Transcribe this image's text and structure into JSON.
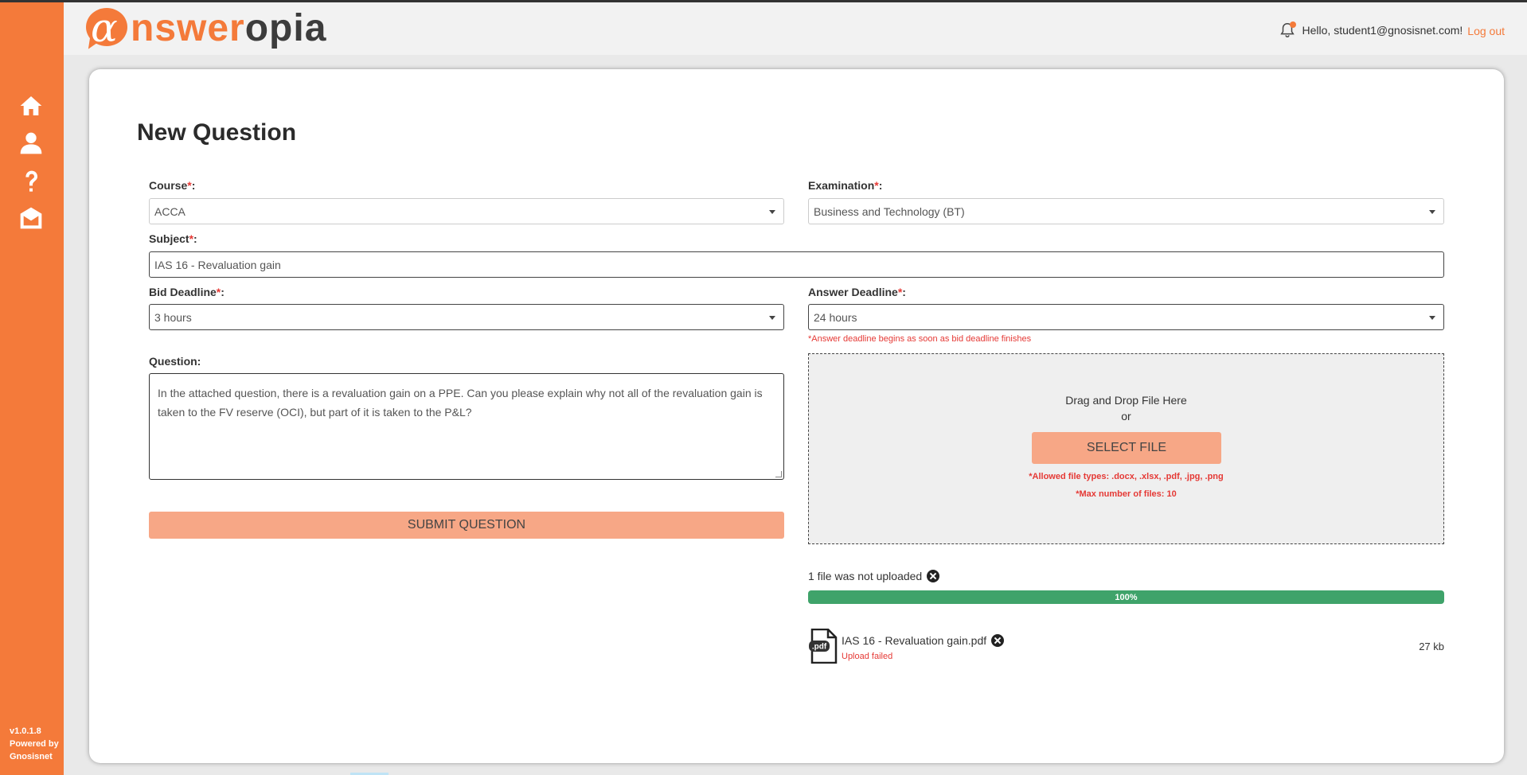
{
  "app": {
    "logo_part1": "nswer",
    "logo_part2": "opia",
    "logo_alpha": "α",
    "version": "v1.0.1.8",
    "powered_by": "Powered by",
    "powered_name": "Gnosisnet"
  },
  "header": {
    "greeting": "Hello, student1@gnosisnet.com!",
    "logout_label": "Log out"
  },
  "sidebar": {
    "items": [
      {
        "icon": "home-icon"
      },
      {
        "icon": "user-icon"
      },
      {
        "icon": "question-icon"
      },
      {
        "icon": "inbox-icon"
      }
    ]
  },
  "form": {
    "title": "New Question",
    "course_label": "Course",
    "course_value": "ACCA",
    "examination_label": "Examination",
    "examination_value": "Business and Technology (BT)",
    "subject_label": "Subject",
    "subject_value": "IAS 16 - Revaluation gain",
    "bid_deadline_label": "Bid Deadline",
    "bid_deadline_value": "3 hours",
    "answer_deadline_label": "Answer Deadline",
    "answer_deadline_value": "24 hours",
    "answer_deadline_note": "*Answer deadline begins as soon as bid deadline finishes",
    "question_label": "Question:",
    "question_value": "In the attached question, there is a revaluation gain on a PPE. Can you please explain why not all of the revaluation gain is taken to the FV reserve (OCI), but part of it is taken to the P&L?",
    "submit_label": "SUBMIT QUESTION",
    "required_mark": "*",
    "colon": ":"
  },
  "upload": {
    "drag_text": "Drag and Drop File Here",
    "or_text": "or",
    "select_label": "SELECT FILE",
    "allowed_types": "*Allowed file types: .docx, .xlsx, .pdf, .jpg, .png",
    "max_files": "*Max number of files: 10",
    "status_text": "1 file was not uploaded",
    "progress_value": 100,
    "progress_label": "100%",
    "file_ext": ".pdf",
    "file_name": "IAS 16 - Revaluation gain.pdf",
    "file_status": "Upload failed",
    "file_size": "27 kb"
  },
  "colors": {
    "brand": "#f47a3a",
    "button": "#f7a786",
    "progress": "#3fa36a",
    "error": "#e53935"
  }
}
